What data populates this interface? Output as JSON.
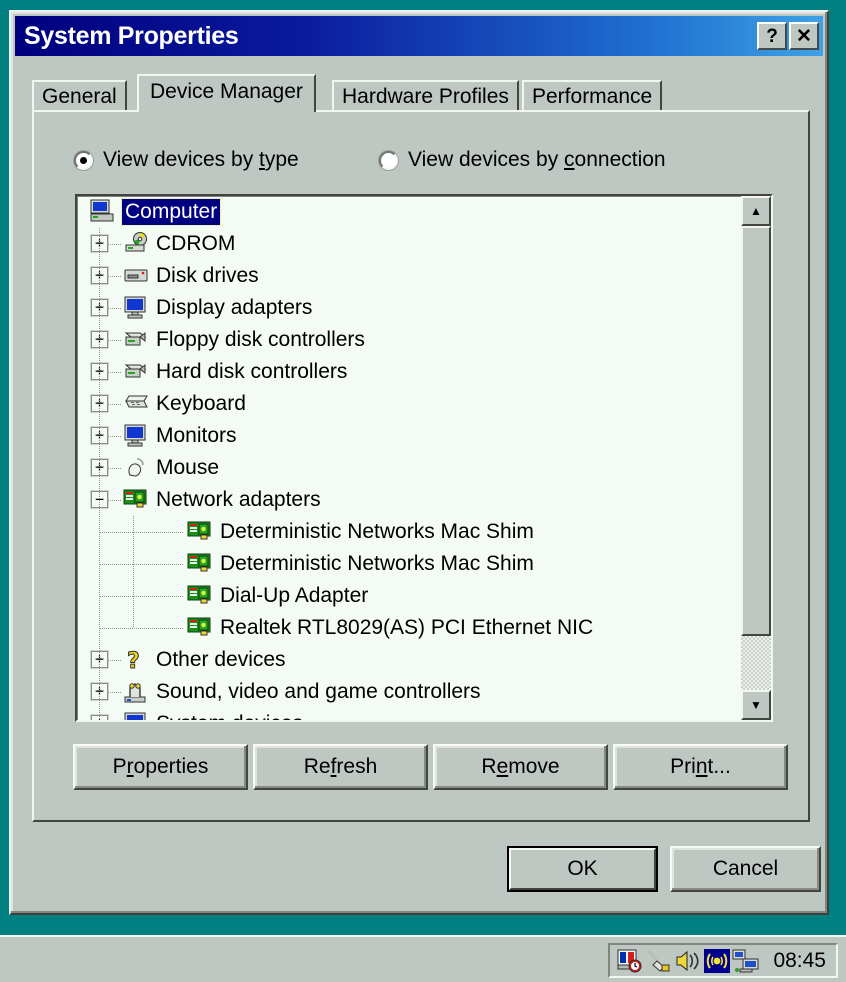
{
  "desktop": {
    "background_color": "#008080"
  },
  "window": {
    "title": "System Properties",
    "titlebar_color_start": "#000080",
    "titlebar_color_end": "#3ea1e6",
    "buttons": [
      {
        "name": "help-button",
        "label": "?"
      },
      {
        "name": "close-button",
        "label": "✕"
      }
    ]
  },
  "tabs": [
    {
      "label": "General",
      "active": false
    },
    {
      "label": "Device Manager",
      "active": true
    },
    {
      "label": "Hardware Profiles",
      "active": false
    },
    {
      "label": "Performance",
      "active": false
    }
  ],
  "view_options": [
    {
      "id": "by-type",
      "label_before": "View devices by ",
      "accel": "t",
      "label_after": "ype",
      "checked": true
    },
    {
      "id": "by-connection",
      "label_before": "View devices by ",
      "accel": "c",
      "label_after": "onnection",
      "checked": false
    }
  ],
  "device_tree": {
    "selected": "Computer",
    "selection_color": "#000080",
    "background_color": "#f4faf4",
    "rows": [
      {
        "label": "Computer",
        "level": 0,
        "icon": "computer-icon",
        "expander": "none",
        "selected": true
      },
      {
        "label": "CDROM",
        "level": 1,
        "icon": "cdrom-icon",
        "expander": "plus",
        "selected": false
      },
      {
        "label": "Disk drives",
        "level": 1,
        "icon": "disk-drive-icon",
        "expander": "plus",
        "selected": false
      },
      {
        "label": "Display adapters",
        "level": 1,
        "icon": "monitor-icon",
        "expander": "plus",
        "selected": false
      },
      {
        "label": "Floppy disk controllers",
        "level": 1,
        "icon": "controller-icon",
        "expander": "plus",
        "selected": false
      },
      {
        "label": "Hard disk controllers",
        "level": 1,
        "icon": "controller-icon",
        "expander": "plus",
        "selected": false
      },
      {
        "label": "Keyboard",
        "level": 1,
        "icon": "keyboard-icon",
        "expander": "plus",
        "selected": false
      },
      {
        "label": "Monitors",
        "level": 1,
        "icon": "monitor-icon",
        "expander": "plus",
        "selected": false
      },
      {
        "label": "Mouse",
        "level": 1,
        "icon": "mouse-icon",
        "expander": "plus",
        "selected": false
      },
      {
        "label": "Network adapters",
        "level": 1,
        "icon": "network-card-icon",
        "expander": "minus",
        "selected": false
      },
      {
        "label": "Deterministic Networks Mac Shim",
        "level": 2,
        "icon": "network-card-icon",
        "expander": "none",
        "selected": false
      },
      {
        "label": "Deterministic Networks Mac Shim",
        "level": 2,
        "icon": "network-card-icon",
        "expander": "none",
        "selected": false
      },
      {
        "label": "Dial-Up Adapter",
        "level": 2,
        "icon": "network-card-icon",
        "expander": "none",
        "selected": false
      },
      {
        "label": "Realtek RTL8029(AS) PCI Ethernet NIC",
        "level": 2,
        "icon": "network-card-icon",
        "expander": "none",
        "selected": false
      },
      {
        "label": "Other devices",
        "level": 1,
        "icon": "unknown-device-icon",
        "expander": "plus",
        "selected": false
      },
      {
        "label": "Sound, video and game controllers",
        "level": 1,
        "icon": "sound-icon",
        "expander": "plus",
        "selected": false
      },
      {
        "label": "System devices",
        "level": 1,
        "icon": "monitor-icon",
        "expander": "plus",
        "selected": false
      }
    ]
  },
  "scrollbar": {
    "up_arrow": "▲",
    "down_arrow": "▼"
  },
  "device_buttons": [
    {
      "id": "properties",
      "before": "P",
      "accel": "r",
      "after": "operties"
    },
    {
      "id": "refresh",
      "before": "Re",
      "accel": "f",
      "after": "resh"
    },
    {
      "id": "remove",
      "before": "R",
      "accel": "e",
      "after": "move"
    },
    {
      "id": "print",
      "before": "Pri",
      "accel": "n",
      "after": "t..."
    }
  ],
  "dialog_buttons": {
    "ok": "OK",
    "cancel": "Cancel"
  },
  "taskbar": {
    "clock": "08:45",
    "tray_icons": [
      "task-scheduler-icon",
      "dialup-connection-icon",
      "volume-speaker-icon",
      "wireless-signal-icon",
      "network-computers-icon"
    ]
  }
}
